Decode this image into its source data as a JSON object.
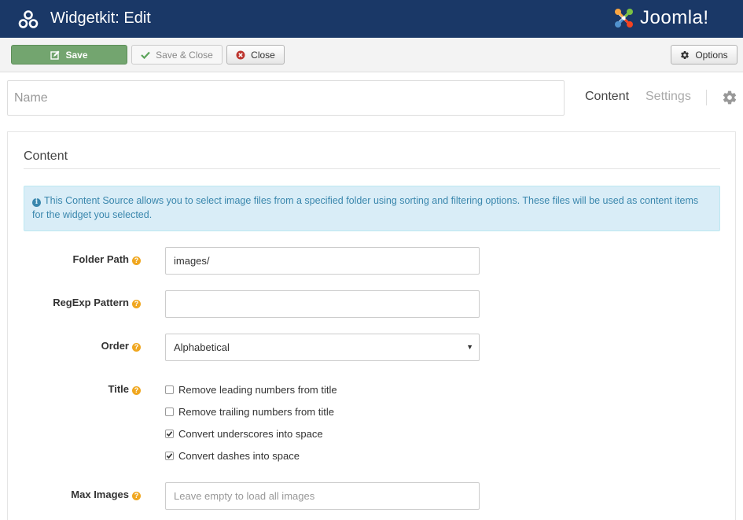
{
  "header": {
    "title": "Widgetkit: Edit",
    "brand": "Joomla!"
  },
  "toolbar": {
    "save_label": "Save",
    "save_close_label": "Save & Close",
    "close_label": "Close",
    "options_label": "Options"
  },
  "name_field": {
    "placeholder": "Name",
    "value": ""
  },
  "tabs": {
    "content": "Content",
    "settings": "Settings",
    "active": "Content"
  },
  "panel": {
    "title": "Content",
    "info": "This Content Source allows you to select image files from a specified folder using sorting and filtering options. These files will be used as content items for the widget you selected."
  },
  "form": {
    "folder_path": {
      "label": "Folder Path",
      "value": "images/"
    },
    "regexp_pattern": {
      "label": "RegExp Pattern",
      "value": ""
    },
    "order": {
      "label": "Order",
      "value": "Alphabetical"
    },
    "title": {
      "label": "Title",
      "options": [
        {
          "label": "Remove leading numbers from title",
          "checked": false
        },
        {
          "label": "Remove trailing numbers from title",
          "checked": false
        },
        {
          "label": "Convert underscores into space",
          "checked": true
        },
        {
          "label": "Convert dashes into space",
          "checked": true
        }
      ]
    },
    "max_images": {
      "label": "Max Images",
      "value": "",
      "placeholder": "Leave empty to load all images"
    }
  },
  "colors": {
    "header_bg": "#1a3867",
    "save_bg": "#73a56f",
    "info_bg": "#d9edf7",
    "info_text": "#3a87ad",
    "help_icon": "#f0a720"
  }
}
